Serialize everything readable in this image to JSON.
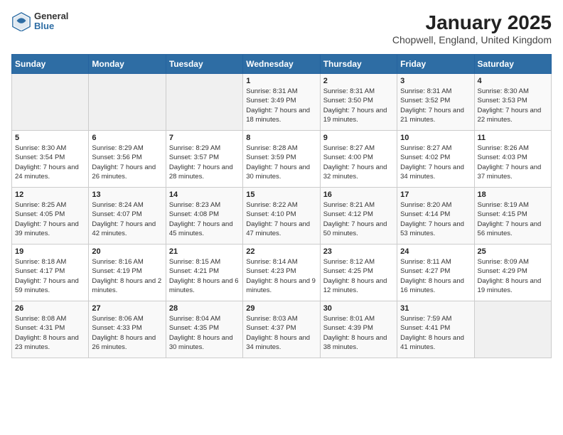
{
  "header": {
    "logo": {
      "general": "General",
      "blue": "Blue"
    },
    "title": "January 2025",
    "subtitle": "Chopwell, England, United Kingdom"
  },
  "weekdays": [
    "Sunday",
    "Monday",
    "Tuesday",
    "Wednesday",
    "Thursday",
    "Friday",
    "Saturday"
  ],
  "weeks": [
    [
      {
        "day": "",
        "sunrise": "",
        "sunset": "",
        "daylight": ""
      },
      {
        "day": "",
        "sunrise": "",
        "sunset": "",
        "daylight": ""
      },
      {
        "day": "",
        "sunrise": "",
        "sunset": "",
        "daylight": ""
      },
      {
        "day": "1",
        "sunrise": "Sunrise: 8:31 AM",
        "sunset": "Sunset: 3:49 PM",
        "daylight": "Daylight: 7 hours and 18 minutes."
      },
      {
        "day": "2",
        "sunrise": "Sunrise: 8:31 AM",
        "sunset": "Sunset: 3:50 PM",
        "daylight": "Daylight: 7 hours and 19 minutes."
      },
      {
        "day": "3",
        "sunrise": "Sunrise: 8:31 AM",
        "sunset": "Sunset: 3:52 PM",
        "daylight": "Daylight: 7 hours and 21 minutes."
      },
      {
        "day": "4",
        "sunrise": "Sunrise: 8:30 AM",
        "sunset": "Sunset: 3:53 PM",
        "daylight": "Daylight: 7 hours and 22 minutes."
      }
    ],
    [
      {
        "day": "5",
        "sunrise": "Sunrise: 8:30 AM",
        "sunset": "Sunset: 3:54 PM",
        "daylight": "Daylight: 7 hours and 24 minutes."
      },
      {
        "day": "6",
        "sunrise": "Sunrise: 8:29 AM",
        "sunset": "Sunset: 3:56 PM",
        "daylight": "Daylight: 7 hours and 26 minutes."
      },
      {
        "day": "7",
        "sunrise": "Sunrise: 8:29 AM",
        "sunset": "Sunset: 3:57 PM",
        "daylight": "Daylight: 7 hours and 28 minutes."
      },
      {
        "day": "8",
        "sunrise": "Sunrise: 8:28 AM",
        "sunset": "Sunset: 3:59 PM",
        "daylight": "Daylight: 7 hours and 30 minutes."
      },
      {
        "day": "9",
        "sunrise": "Sunrise: 8:27 AM",
        "sunset": "Sunset: 4:00 PM",
        "daylight": "Daylight: 7 hours and 32 minutes."
      },
      {
        "day": "10",
        "sunrise": "Sunrise: 8:27 AM",
        "sunset": "Sunset: 4:02 PM",
        "daylight": "Daylight: 7 hours and 34 minutes."
      },
      {
        "day": "11",
        "sunrise": "Sunrise: 8:26 AM",
        "sunset": "Sunset: 4:03 PM",
        "daylight": "Daylight: 7 hours and 37 minutes."
      }
    ],
    [
      {
        "day": "12",
        "sunrise": "Sunrise: 8:25 AM",
        "sunset": "Sunset: 4:05 PM",
        "daylight": "Daylight: 7 hours and 39 minutes."
      },
      {
        "day": "13",
        "sunrise": "Sunrise: 8:24 AM",
        "sunset": "Sunset: 4:07 PM",
        "daylight": "Daylight: 7 hours and 42 minutes."
      },
      {
        "day": "14",
        "sunrise": "Sunrise: 8:23 AM",
        "sunset": "Sunset: 4:08 PM",
        "daylight": "Daylight: 7 hours and 45 minutes."
      },
      {
        "day": "15",
        "sunrise": "Sunrise: 8:22 AM",
        "sunset": "Sunset: 4:10 PM",
        "daylight": "Daylight: 7 hours and 47 minutes."
      },
      {
        "day": "16",
        "sunrise": "Sunrise: 8:21 AM",
        "sunset": "Sunset: 4:12 PM",
        "daylight": "Daylight: 7 hours and 50 minutes."
      },
      {
        "day": "17",
        "sunrise": "Sunrise: 8:20 AM",
        "sunset": "Sunset: 4:14 PM",
        "daylight": "Daylight: 7 hours and 53 minutes."
      },
      {
        "day": "18",
        "sunrise": "Sunrise: 8:19 AM",
        "sunset": "Sunset: 4:15 PM",
        "daylight": "Daylight: 7 hours and 56 minutes."
      }
    ],
    [
      {
        "day": "19",
        "sunrise": "Sunrise: 8:18 AM",
        "sunset": "Sunset: 4:17 PM",
        "daylight": "Daylight: 7 hours and 59 minutes."
      },
      {
        "day": "20",
        "sunrise": "Sunrise: 8:16 AM",
        "sunset": "Sunset: 4:19 PM",
        "daylight": "Daylight: 8 hours and 2 minutes."
      },
      {
        "day": "21",
        "sunrise": "Sunrise: 8:15 AM",
        "sunset": "Sunset: 4:21 PM",
        "daylight": "Daylight: 8 hours and 6 minutes."
      },
      {
        "day": "22",
        "sunrise": "Sunrise: 8:14 AM",
        "sunset": "Sunset: 4:23 PM",
        "daylight": "Daylight: 8 hours and 9 minutes."
      },
      {
        "day": "23",
        "sunrise": "Sunrise: 8:12 AM",
        "sunset": "Sunset: 4:25 PM",
        "daylight": "Daylight: 8 hours and 12 minutes."
      },
      {
        "day": "24",
        "sunrise": "Sunrise: 8:11 AM",
        "sunset": "Sunset: 4:27 PM",
        "daylight": "Daylight: 8 hours and 16 minutes."
      },
      {
        "day": "25",
        "sunrise": "Sunrise: 8:09 AM",
        "sunset": "Sunset: 4:29 PM",
        "daylight": "Daylight: 8 hours and 19 minutes."
      }
    ],
    [
      {
        "day": "26",
        "sunrise": "Sunrise: 8:08 AM",
        "sunset": "Sunset: 4:31 PM",
        "daylight": "Daylight: 8 hours and 23 minutes."
      },
      {
        "day": "27",
        "sunrise": "Sunrise: 8:06 AM",
        "sunset": "Sunset: 4:33 PM",
        "daylight": "Daylight: 8 hours and 26 minutes."
      },
      {
        "day": "28",
        "sunrise": "Sunrise: 8:04 AM",
        "sunset": "Sunset: 4:35 PM",
        "daylight": "Daylight: 8 hours and 30 minutes."
      },
      {
        "day": "29",
        "sunrise": "Sunrise: 8:03 AM",
        "sunset": "Sunset: 4:37 PM",
        "daylight": "Daylight: 8 hours and 34 minutes."
      },
      {
        "day": "30",
        "sunrise": "Sunrise: 8:01 AM",
        "sunset": "Sunset: 4:39 PM",
        "daylight": "Daylight: 8 hours and 38 minutes."
      },
      {
        "day": "31",
        "sunrise": "Sunrise: 7:59 AM",
        "sunset": "Sunset: 4:41 PM",
        "daylight": "Daylight: 8 hours and 41 minutes."
      },
      {
        "day": "",
        "sunrise": "",
        "sunset": "",
        "daylight": ""
      }
    ]
  ]
}
